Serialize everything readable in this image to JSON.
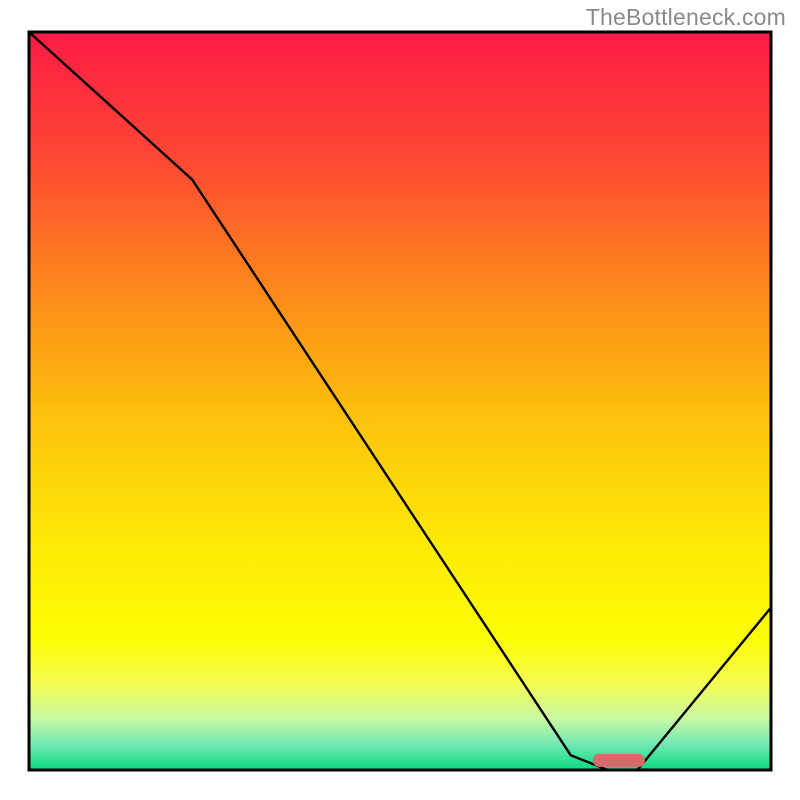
{
  "watermark": "TheBottleneck.com",
  "chart_data": {
    "type": "line",
    "title": "",
    "xlabel": "",
    "ylabel": "",
    "xlim": [
      0,
      100
    ],
    "ylim": [
      0,
      100
    ],
    "series": [
      {
        "name": "bottleneck-curve",
        "x": [
          0,
          22,
          73,
          78,
          82,
          100
        ],
        "y": [
          100,
          80,
          2,
          0,
          0,
          22
        ]
      }
    ],
    "marker": {
      "name": "optimal-range",
      "x_start": 76,
      "x_end": 83,
      "y": 1.3,
      "color": "#d66a6a"
    },
    "gradient_stops": [
      {
        "offset": 0.0,
        "color": "#fd1b46"
      },
      {
        "offset": 0.17,
        "color": "#fd4733"
      },
      {
        "offset": 0.36,
        "color": "#fd8c1a"
      },
      {
        "offset": 0.53,
        "color": "#fdc40c"
      },
      {
        "offset": 0.7,
        "color": "#fdeb06"
      },
      {
        "offset": 0.82,
        "color": "#fdfd03"
      },
      {
        "offset": 0.88,
        "color": "#f5fd4f"
      },
      {
        "offset": 0.93,
        "color": "#c9f9a3"
      },
      {
        "offset": 0.965,
        "color": "#72e9b4"
      },
      {
        "offset": 1.0,
        "color": "#07db7f"
      }
    ],
    "border_color": "#000000",
    "line_color": "#000000",
    "line_width": 2.4
  }
}
